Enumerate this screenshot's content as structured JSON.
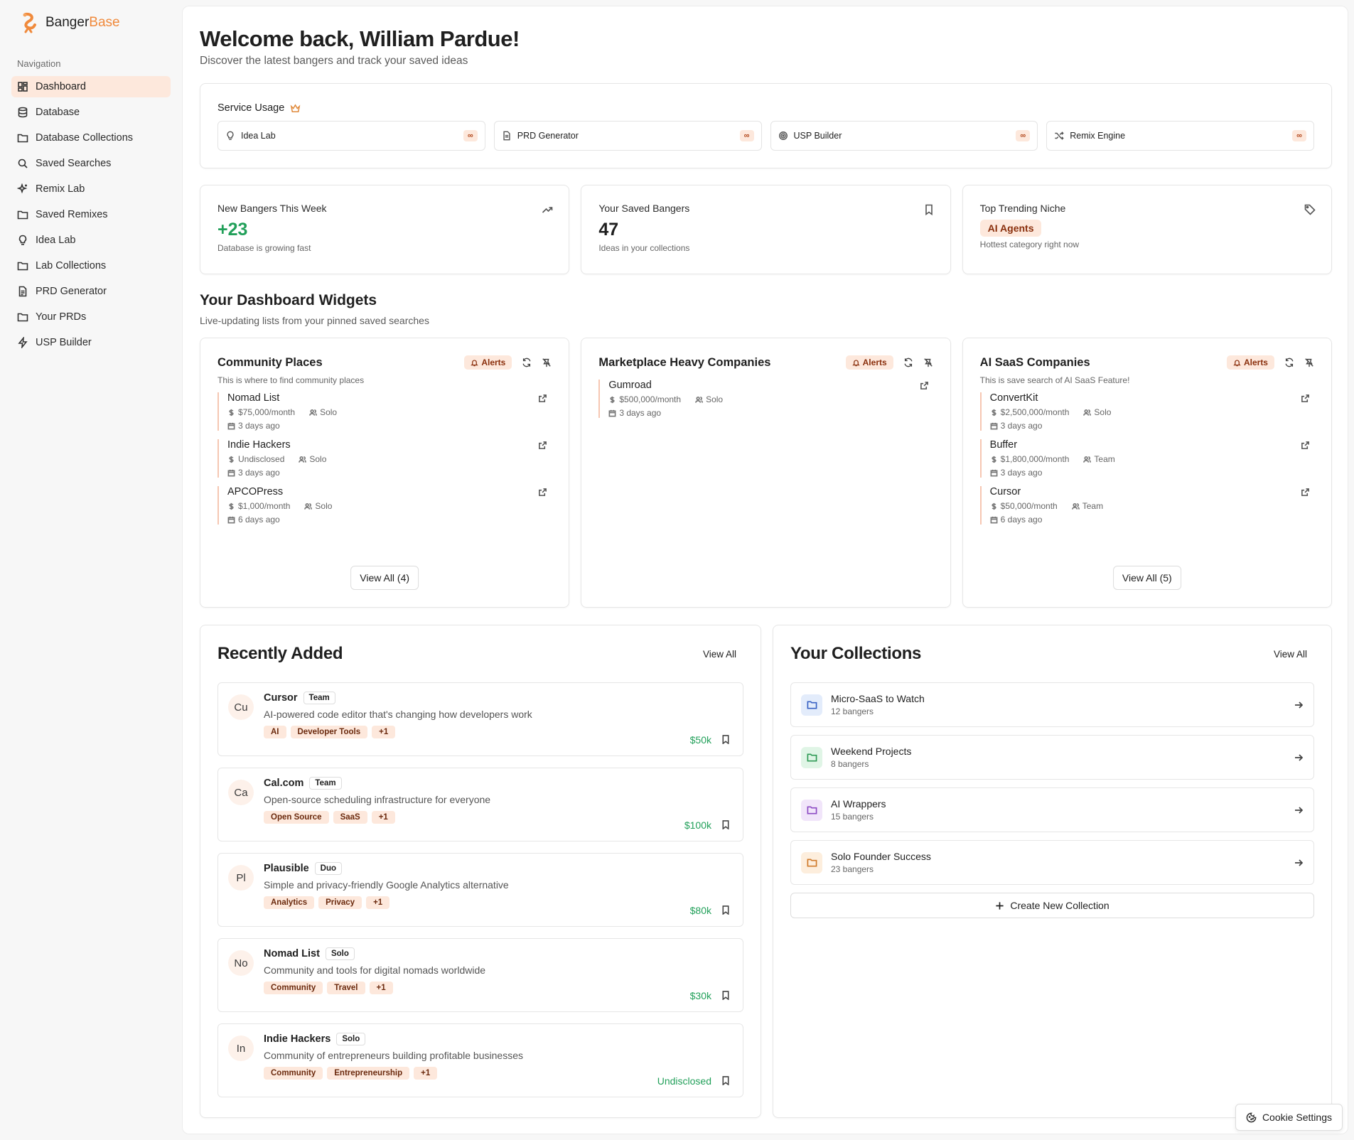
{
  "brand": {
    "name_part1": "Banger",
    "name_part2": "Base",
    "accent_color": "#f08a3c"
  },
  "sidebar": {
    "heading": "Navigation",
    "items": [
      {
        "label": "Dashboard",
        "icon": "dashboard-icon",
        "active": true
      },
      {
        "label": "Database",
        "icon": "database-icon"
      },
      {
        "label": "Database Collections",
        "icon": "folder-icon"
      },
      {
        "label": "Saved Searches",
        "icon": "search-icon"
      },
      {
        "label": "Remix Lab",
        "icon": "sparkles-icon"
      },
      {
        "label": "Saved Remixes",
        "icon": "folder-icon"
      },
      {
        "label": "Idea Lab",
        "icon": "lightbulb-icon"
      },
      {
        "label": "Lab Collections",
        "icon": "folder-icon"
      },
      {
        "label": "PRD Generator",
        "icon": "document-icon"
      },
      {
        "label": "Your PRDs",
        "icon": "folder-icon"
      },
      {
        "label": "USP Builder",
        "icon": "zap-icon"
      }
    ]
  },
  "header": {
    "title": "Welcome back, William Pardue!",
    "subtitle": "Discover the latest bangers and track your saved ideas"
  },
  "usage": {
    "title": "Service Usage",
    "items": [
      {
        "label": "Idea Lab",
        "icon": "lightbulb-icon",
        "limit": "∞"
      },
      {
        "label": "PRD Generator",
        "icon": "document-icon",
        "limit": "∞"
      },
      {
        "label": "USP Builder",
        "icon": "target-icon",
        "limit": "∞"
      },
      {
        "label": "Remix Engine",
        "icon": "shuffle-icon",
        "limit": "∞"
      }
    ]
  },
  "stats": {
    "new_bangers": {
      "label": "New Bangers This Week",
      "value": "+23",
      "desc": "Database is growing fast"
    },
    "saved": {
      "label": "Your Saved Bangers",
      "value": "47",
      "desc": "Ideas in your collections"
    },
    "niche": {
      "label": "Top Trending Niche",
      "value": "AI Agents",
      "desc": "Hottest category right now"
    }
  },
  "widgets_section": {
    "title": "Your Dashboard Widgets",
    "subtitle": "Live-updating lists from your pinned saved searches"
  },
  "widgets": [
    {
      "title": "Community Places",
      "alerts": "Alerts",
      "desc": "This is where to find community places",
      "entries": [
        {
          "name": "Nomad List",
          "revenue": "$75,000/month",
          "team": "Solo",
          "date": "3 days ago"
        },
        {
          "name": "Indie Hackers",
          "revenue": "Undisclosed",
          "team": "Solo",
          "date": "3 days ago"
        },
        {
          "name": "APCOPress",
          "revenue": "$1,000/month",
          "team": "Solo",
          "date": "6 days ago"
        }
      ],
      "view_all": "View All (4)"
    },
    {
      "title": "Marketplace Heavy Companies",
      "alerts": "Alerts",
      "desc": "",
      "entries": [
        {
          "name": "Gumroad",
          "revenue": "$500,000/month",
          "team": "Solo",
          "date": "3 days ago"
        }
      ],
      "view_all": ""
    },
    {
      "title": "AI SaaS Companies",
      "alerts": "Alerts",
      "desc": "This is save search of AI SaaS Feature!",
      "entries": [
        {
          "name": "ConvertKit",
          "revenue": "$2,500,000/month",
          "team": "Solo",
          "date": "3 days ago"
        },
        {
          "name": "Buffer",
          "revenue": "$1,800,000/month",
          "team": "Team",
          "date": "3 days ago"
        },
        {
          "name": "Cursor",
          "revenue": "$50,000/month",
          "team": "Team",
          "date": "6 days ago"
        }
      ],
      "view_all": "View All (5)"
    }
  ],
  "recent": {
    "title": "Recently Added",
    "view_all": "View All",
    "items": [
      {
        "initials": "Cu",
        "name": "Cursor",
        "type": "Team",
        "desc": "AI-powered code editor that's changing how developers work",
        "tags": [
          "AI",
          "Developer Tools",
          "+1"
        ],
        "revenue": "$50k"
      },
      {
        "initials": "Ca",
        "name": "Cal.com",
        "type": "Team",
        "desc": "Open-source scheduling infrastructure for everyone",
        "tags": [
          "Open Source",
          "SaaS",
          "+1"
        ],
        "revenue": "$100k"
      },
      {
        "initials": "Pl",
        "name": "Plausible",
        "type": "Duo",
        "desc": "Simple and privacy-friendly Google Analytics alternative",
        "tags": [
          "Analytics",
          "Privacy",
          "+1"
        ],
        "revenue": "$80k"
      },
      {
        "initials": "No",
        "name": "Nomad List",
        "type": "Solo",
        "desc": "Community and tools for digital nomads worldwide",
        "tags": [
          "Community",
          "Travel",
          "+1"
        ],
        "revenue": "$30k"
      },
      {
        "initials": "In",
        "name": "Indie Hackers",
        "type": "Solo",
        "desc": "Community of entrepreneurs building profitable businesses",
        "tags": [
          "Community",
          "Entrepreneurship",
          "+1"
        ],
        "revenue": "Undisclosed"
      }
    ]
  },
  "collections": {
    "title": "Your Collections",
    "view_all": "View All",
    "items": [
      {
        "name": "Micro-SaaS to Watch",
        "count": "12 bangers",
        "bg": "#e3ecfb",
        "stroke": "#3b63c4"
      },
      {
        "name": "Weekend Projects",
        "count": "8 bangers",
        "bg": "#e0f5e6",
        "stroke": "#2f9a55"
      },
      {
        "name": "AI Wrappers",
        "count": "15 bangers",
        "bg": "#f1e5fa",
        "stroke": "#8d4bc4"
      },
      {
        "name": "Solo Founder Success",
        "count": "23 bangers",
        "bg": "#fdeedd",
        "stroke": "#d07a2a"
      }
    ],
    "create_label": "Create New Collection"
  },
  "cookie": {
    "label": "Cookie Settings"
  }
}
